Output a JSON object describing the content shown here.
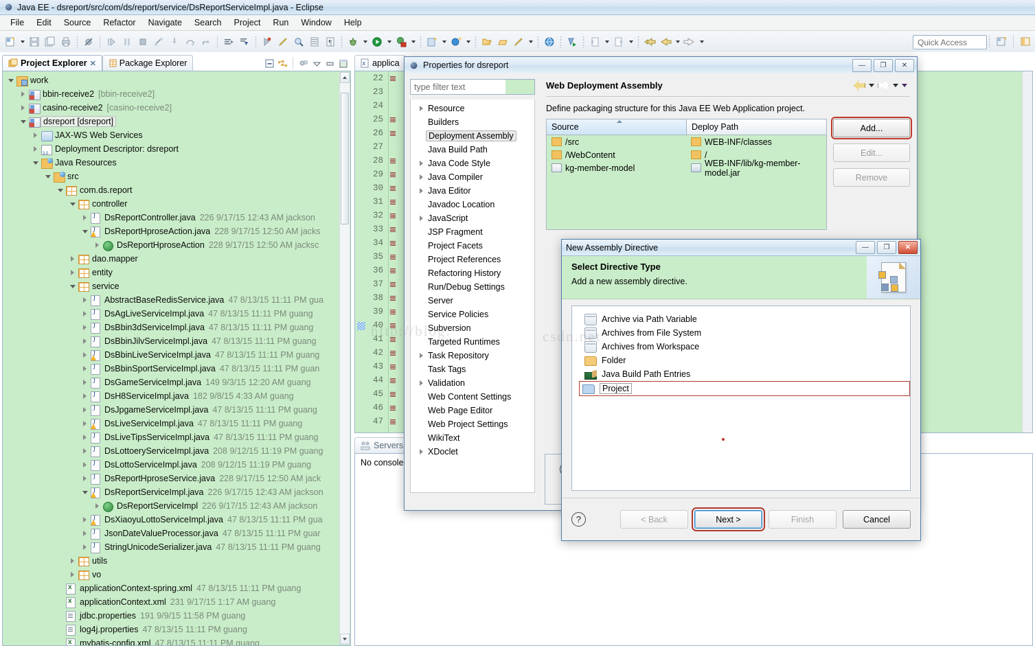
{
  "window": {
    "title": "Java EE - dsreport/src/com/ds/report/service/DsReportServiceImpl.java - Eclipse",
    "app_icon": "eclipse-icon"
  },
  "menubar": [
    "File",
    "Edit",
    "Source",
    "Refactor",
    "Navigate",
    "Search",
    "Project",
    "Run",
    "Window",
    "Help"
  ],
  "toolbar": {
    "quick_access_placeholder": "Quick Access"
  },
  "project_explorer": {
    "tabs": [
      {
        "label": "Project Explorer",
        "active": true,
        "icon": "project-explorer-icon",
        "closable": true
      },
      {
        "label": "Package Explorer",
        "active": false,
        "icon": "package-explorer-icon",
        "closable": false
      }
    ],
    "toolbar_icons": [
      "collapse-all-icon",
      "link-with-editor-icon",
      "focus-icon",
      "view-menu-icon",
      "minimize-icon",
      "maximize-icon"
    ],
    "tree": [
      {
        "indent": 0,
        "tw": "open",
        "icon": "working-set-icon",
        "label": "work",
        "meta": ""
      },
      {
        "indent": 1,
        "tw": "closed",
        "icon": "project-icon-error",
        "label": "bbin-receive2",
        "meta": "[bbin-receive2]"
      },
      {
        "indent": 1,
        "tw": "closed",
        "icon": "project-icon-error",
        "label": "casino-receive2",
        "meta": "[casino-receive2]"
      },
      {
        "indent": 1,
        "tw": "open",
        "icon": "project-icon-error",
        "label": "dsreport [dsreport]",
        "meta": "",
        "selected": true
      },
      {
        "indent": 2,
        "tw": "closed",
        "icon": "jaxws-icon",
        "label": "JAX-WS Web Services",
        "meta": ""
      },
      {
        "indent": 2,
        "tw": "closed",
        "icon": "deployment-descriptor-icon",
        "label": "Deployment Descriptor: dsreport",
        "meta": ""
      },
      {
        "indent": 2,
        "tw": "open",
        "icon": "java-resources-icon",
        "label": "Java Resources",
        "meta": ""
      },
      {
        "indent": 3,
        "tw": "open",
        "icon": "source-folder-icon",
        "label": "src",
        "meta": ""
      },
      {
        "indent": 4,
        "tw": "open",
        "icon": "package-icon",
        "label": "com.ds.report",
        "meta": ""
      },
      {
        "indent": 5,
        "tw": "open",
        "icon": "package-icon",
        "label": "controller",
        "meta": ""
      },
      {
        "indent": 6,
        "tw": "closed",
        "icon": "java-file-icon",
        "label": "DsReportController.java",
        "meta": "226  9/17/15 12:43 AM  jackson"
      },
      {
        "indent": 6,
        "tw": "open",
        "icon": "java-file-icon-warn",
        "label": "DsReportHproseAction.java",
        "meta": "228  9/17/15 12:50 AM  jacks"
      },
      {
        "indent": 7,
        "tw": "closed",
        "icon": "java-class-icon",
        "label": "DsReportHproseAction",
        "meta": "228  9/17/15 12:50 AM  jacksc"
      },
      {
        "indent": 5,
        "tw": "closed",
        "icon": "package-icon",
        "label": "dao.mapper",
        "meta": ""
      },
      {
        "indent": 5,
        "tw": "closed",
        "icon": "package-icon",
        "label": "entity",
        "meta": ""
      },
      {
        "indent": 5,
        "tw": "open",
        "icon": "package-icon-warn",
        "label": "service",
        "meta": ""
      },
      {
        "indent": 6,
        "tw": "closed",
        "icon": "java-file-icon",
        "label": "AbstractBaseRedisService.java",
        "meta": "47  8/13/15 11:11 PM  gua"
      },
      {
        "indent": 6,
        "tw": "closed",
        "icon": "java-file-icon",
        "label": "DsAgLiveServiceImpl.java",
        "meta": "47  8/13/15 11:11 PM  guang"
      },
      {
        "indent": 6,
        "tw": "closed",
        "icon": "java-file-icon",
        "label": "DsBbin3dServiceImpl.java",
        "meta": "47  8/13/15 11:11 PM  guang"
      },
      {
        "indent": 6,
        "tw": "closed",
        "icon": "java-file-icon",
        "label": "DsBbinJilvServiceImpl.java",
        "meta": "47  8/13/15 11:11 PM  guang"
      },
      {
        "indent": 6,
        "tw": "closed",
        "icon": "java-file-icon-warn",
        "label": "DsBbinLiveServiceImpl.java",
        "meta": "47  8/13/15 11:11 PM  guang"
      },
      {
        "indent": 6,
        "tw": "closed",
        "icon": "java-file-icon",
        "label": "DsBbinSportServiceImpl.java",
        "meta": "47  8/13/15 11:11 PM  guan"
      },
      {
        "indent": 6,
        "tw": "closed",
        "icon": "java-file-icon",
        "label": "DsGameServiceImpl.java",
        "meta": "149  9/3/15 12:20 AM  guang"
      },
      {
        "indent": 6,
        "tw": "closed",
        "icon": "java-file-icon",
        "label": "DsH8ServiceImpl.java",
        "meta": "182  9/8/15 4:33 AM  guang"
      },
      {
        "indent": 6,
        "tw": "closed",
        "icon": "java-file-icon",
        "label": "DsJpgameServiceImpl.java",
        "meta": "47  8/13/15 11:11 PM  guang"
      },
      {
        "indent": 6,
        "tw": "closed",
        "icon": "java-file-icon-warn",
        "label": "DsLiveServiceImpl.java",
        "meta": "47  8/13/15 11:11 PM  guang"
      },
      {
        "indent": 6,
        "tw": "closed",
        "icon": "java-file-icon",
        "label": "DsLiveTipsServiceImpl.java",
        "meta": "47  8/13/15 11:11 PM  guang"
      },
      {
        "indent": 6,
        "tw": "closed",
        "icon": "java-file-icon",
        "label": "DsLottoeryServiceImpl.java",
        "meta": "208  9/12/15 11:19 PM  guang"
      },
      {
        "indent": 6,
        "tw": "closed",
        "icon": "java-file-icon",
        "label": "DsLottoServiceImpl.java",
        "meta": "208  9/12/15 11:19 PM  guang"
      },
      {
        "indent": 6,
        "tw": "closed",
        "icon": "java-file-icon",
        "label": "DsReportHproseService.java",
        "meta": "228  9/17/15 12:50 AM  jack"
      },
      {
        "indent": 6,
        "tw": "open",
        "icon": "java-file-icon-warn",
        "label": "DsReportServiceImpl.java",
        "meta": "226  9/17/15 12:43 AM  jackson"
      },
      {
        "indent": 7,
        "tw": "closed",
        "icon": "java-class-icon",
        "label": "DsReportServiceImpl",
        "meta": "226  9/17/15 12:43 AM  jackson"
      },
      {
        "indent": 6,
        "tw": "closed",
        "icon": "java-file-icon-warn",
        "label": "DsXiaoyuLottoServiceImpl.java",
        "meta": "47  8/13/15 11:11 PM  gua"
      },
      {
        "indent": 6,
        "tw": "closed",
        "icon": "java-file-icon",
        "label": "JsonDateValueProcessor.java",
        "meta": "47  8/13/15 11:11 PM  guar"
      },
      {
        "indent": 6,
        "tw": "closed",
        "icon": "java-file-icon",
        "label": "StringUnicodeSerializer.java",
        "meta": "47  8/13/15 11:11 PM  guang"
      },
      {
        "indent": 5,
        "tw": "closed",
        "icon": "package-icon-warn",
        "label": "utils",
        "meta": ""
      },
      {
        "indent": 5,
        "tw": "closed",
        "icon": "package-icon",
        "label": "vo",
        "meta": ""
      },
      {
        "indent": 4,
        "tw": "none",
        "icon": "xml-file-icon",
        "label": "applicationContext-spring.xml",
        "meta": "47  8/13/15 11:11 PM  guang"
      },
      {
        "indent": 4,
        "tw": "none",
        "icon": "xml-file-icon",
        "label": "applicationContext.xml",
        "meta": "231  9/17/15 1:17 AM  guang"
      },
      {
        "indent": 4,
        "tw": "none",
        "icon": "properties-file-icon",
        "label": "jdbc.properties",
        "meta": "191  9/9/15 11:58 PM  guang"
      },
      {
        "indent": 4,
        "tw": "none",
        "icon": "properties-file-icon",
        "label": "log4j.properties",
        "meta": "47  8/13/15 11:11 PM  guang"
      },
      {
        "indent": 4,
        "tw": "none",
        "icon": "xml-file-icon",
        "label": "mybatis-config.xml",
        "meta": "47  8/13/15 11:11 PM  guang"
      }
    ]
  },
  "editor": {
    "tab_label": "applica",
    "tab_icon": "xml-file-icon",
    "line_numbers": [
      22,
      23,
      24,
      25,
      26,
      27,
      28,
      29,
      30,
      31,
      32,
      33,
      34,
      35,
      36,
      37,
      38,
      39,
      40,
      41,
      42,
      43,
      44,
      45,
      46,
      47
    ]
  },
  "bottom_view": {
    "tab_label": "Servers",
    "tab_icon": "servers-icon",
    "content": "No console"
  },
  "properties_dialog": {
    "title": "Properties for dsreport",
    "window_buttons": [
      "minimize",
      "maximize",
      "close"
    ],
    "filter_placeholder": "type filter text",
    "tree": [
      {
        "label": "Resource",
        "tw": "closed"
      },
      {
        "label": "Builders",
        "tw": "none"
      },
      {
        "label": "Deployment Assembly",
        "tw": "none",
        "selected": true
      },
      {
        "label": "Java Build Path",
        "tw": "none"
      },
      {
        "label": "Java Code Style",
        "tw": "closed"
      },
      {
        "label": "Java Compiler",
        "tw": "closed"
      },
      {
        "label": "Java Editor",
        "tw": "closed"
      },
      {
        "label": "Javadoc Location",
        "tw": "none"
      },
      {
        "label": "JavaScript",
        "tw": "closed"
      },
      {
        "label": "JSP Fragment",
        "tw": "none"
      },
      {
        "label": "Project Facets",
        "tw": "none"
      },
      {
        "label": "Project References",
        "tw": "none"
      },
      {
        "label": "Refactoring History",
        "tw": "none"
      },
      {
        "label": "Run/Debug Settings",
        "tw": "none"
      },
      {
        "label": "Server",
        "tw": "none"
      },
      {
        "label": "Service Policies",
        "tw": "none"
      },
      {
        "label": "Subversion",
        "tw": "none"
      },
      {
        "label": "Targeted Runtimes",
        "tw": "none"
      },
      {
        "label": "Task Repository",
        "tw": "closed"
      },
      {
        "label": "Task Tags",
        "tw": "none"
      },
      {
        "label": "Validation",
        "tw": "closed"
      },
      {
        "label": "Web Content Settings",
        "tw": "none"
      },
      {
        "label": "Web Page Editor",
        "tw": "none"
      },
      {
        "label": "Web Project Settings",
        "tw": "none"
      },
      {
        "label": "WikiText",
        "tw": "none"
      },
      {
        "label": "XDoclet",
        "tw": "closed"
      }
    ],
    "page_title": "Web Deployment Assembly",
    "description": "Define packaging structure for this Java EE Web Application project.",
    "table": {
      "columns": [
        "Source",
        "Deploy Path"
      ],
      "rows": [
        {
          "source": "/src",
          "source_icon": "folder-icon",
          "deploy": "WEB-INF/classes",
          "deploy_icon": "folder-icon"
        },
        {
          "source": "/WebContent",
          "source_icon": "folder-icon",
          "deploy": "/",
          "deploy_icon": "folder-icon"
        },
        {
          "source": "kg-member-model",
          "source_icon": "module-icon",
          "deploy": "WEB-INF/lib/kg-member-model.jar",
          "deploy_icon": "jar-icon"
        }
      ]
    },
    "buttons": [
      {
        "label": "Add...",
        "mnemonic": "d",
        "enabled": true,
        "highlighted": true
      },
      {
        "label": "Edit...",
        "mnemonic": "E",
        "enabled": false,
        "highlighted": false
      },
      {
        "label": "Remove",
        "mnemonic": "R",
        "enabled": false,
        "highlighted": false
      }
    ],
    "help_icon": "help-icon",
    "nav_icons": [
      "back-arrow-icon",
      "forward-arrow-icon",
      "view-menu-icon"
    ]
  },
  "wizard_dialog": {
    "title": "New Assembly Directive",
    "window_buttons": [
      "minimize",
      "maximize",
      "close"
    ],
    "banner_title": "Select Directive Type",
    "banner_subtitle": "Add a new assembly directive.",
    "banner_image": "assembly-directive-icon",
    "options": [
      {
        "label": "Archive via Path Variable",
        "icon": "jar-icon",
        "selected": false
      },
      {
        "label": "Archives from File System",
        "icon": "jar-icon",
        "selected": false
      },
      {
        "label": "Archives from Workspace",
        "icon": "jar-icon",
        "selected": false
      },
      {
        "label": "Folder",
        "icon": "folder-icon",
        "selected": false
      },
      {
        "label": "Java Build Path Entries",
        "icon": "java-build-path-icon",
        "selected": false
      },
      {
        "label": "Project",
        "icon": "project-folder-icon",
        "selected": true
      }
    ],
    "help_icon": "help-icon",
    "buttons": [
      {
        "label": "< Back",
        "enabled": false,
        "highlighted": false
      },
      {
        "label": "Next >",
        "enabled": true,
        "highlighted": true
      },
      {
        "label": "Finish",
        "enabled": false,
        "highlighted": false
      },
      {
        "label": "Cancel",
        "enabled": true,
        "highlighted": false
      }
    ]
  },
  "watermark": {
    "left": "http://blog.",
    "right": "csdn.net"
  }
}
